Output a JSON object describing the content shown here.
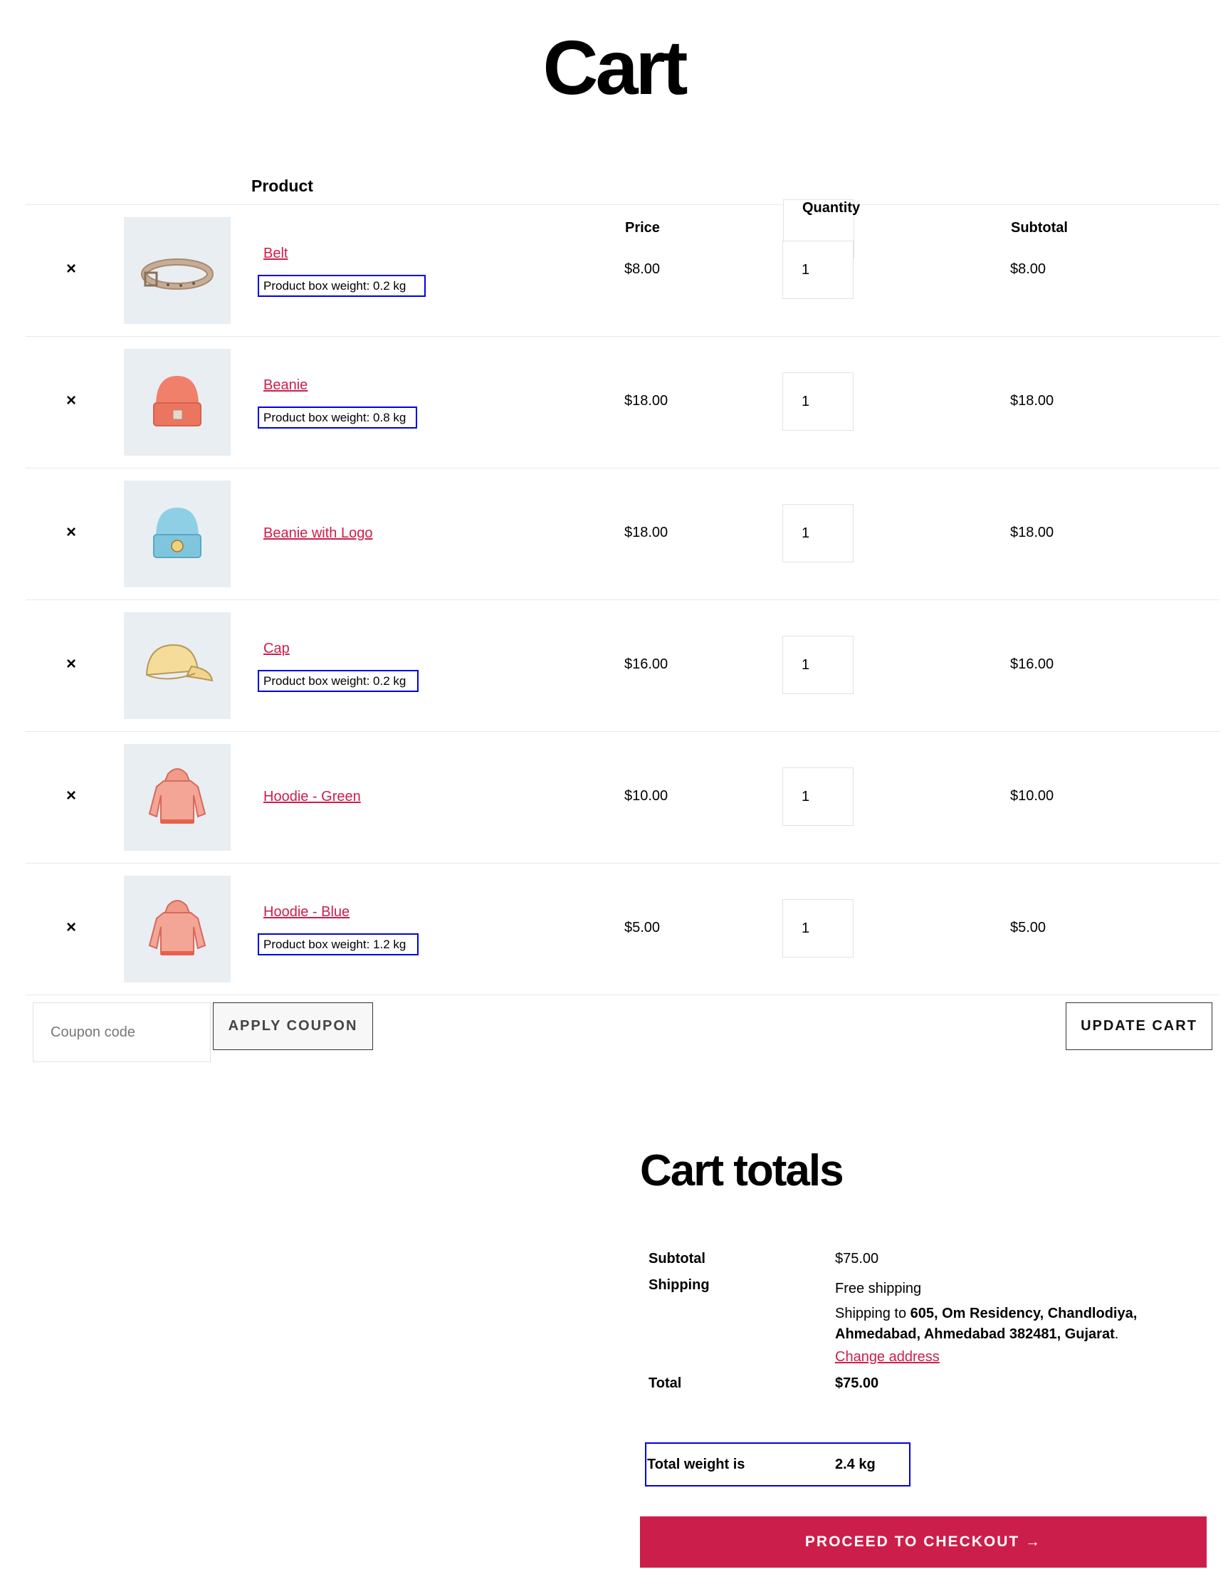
{
  "page": {
    "title": "Cart"
  },
  "table": {
    "headers": {
      "product": "Product",
      "price": "Price",
      "quantity": "Quantity",
      "subtotal": "Subtotal"
    },
    "remove_symbol": "×",
    "items": [
      {
        "name": "Belt",
        "weight": "Product box weight: 0.2 kg",
        "price": "$8.00",
        "qty": "1",
        "subtotal": "$8.00",
        "icon": "belt-icon"
      },
      {
        "name": "Beanie",
        "weight": "Product box weight: 0.8 kg",
        "price": "$18.00",
        "qty": "1",
        "subtotal": "$18.00",
        "icon": "beanie-icon"
      },
      {
        "name": "Beanie with Logo",
        "weight": "",
        "price": "$18.00",
        "qty": "1",
        "subtotal": "$18.00",
        "icon": "beanie-logo-icon"
      },
      {
        "name": "Cap",
        "weight": "Product box weight: 0.2 kg",
        "price": "$16.00",
        "qty": "1",
        "subtotal": "$16.00",
        "icon": "cap-icon"
      },
      {
        "name": "Hoodie - Green",
        "weight": "",
        "price": "$10.00",
        "qty": "1",
        "subtotal": "$10.00",
        "icon": "hoodie-icon"
      },
      {
        "name": "Hoodie - Blue",
        "weight": "Product box weight: 1.2 kg",
        "price": "$5.00",
        "qty": "1",
        "subtotal": "$5.00",
        "icon": "hoodie-icon"
      }
    ]
  },
  "actions": {
    "coupon_placeholder": "Coupon code",
    "apply_label": "APPLY COUPON",
    "update_label": "UPDATE CART"
  },
  "totals": {
    "heading": "Cart totals",
    "subtotal_label": "Subtotal",
    "subtotal_value": "$75.00",
    "shipping_label": "Shipping",
    "shipping_method": "Free shipping",
    "shipping_to_prefix": "Shipping to ",
    "shipping_address": "605, Om Residency, Chandlodiya, Ahmedabad, Ahmedabad 382481, Gujarat",
    "shipping_to_suffix": ".",
    "change_address": "Change address",
    "total_label": "Total",
    "total_value": "$75.00",
    "weight_label": "Total weight is",
    "weight_value": "2.4 kg",
    "checkout_label": "PROCEED TO CHECKOUT →"
  },
  "colors": {
    "accent": "#cc1e4a",
    "highlight_border": "#0000e6",
    "thumb_bg": "#e9eef3"
  }
}
